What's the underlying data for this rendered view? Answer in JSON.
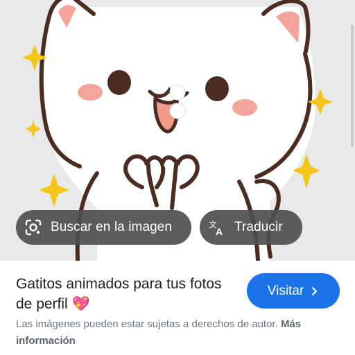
{
  "image_actions": {
    "lens_label": "Buscar en la imagen",
    "translate_label": "Traducir"
  },
  "result": {
    "title": "Gatitos animados para tus fotos de perfil",
    "title_emoji": "💖",
    "visit_label": "Visitar",
    "disclaimer": "Las imágenes pueden estar sujetas a derechos de autor.",
    "more_info": "Más información"
  },
  "colors": {
    "accent": "#1a73e8",
    "chip_bg": "#4e4e4e",
    "image_bg": "#e9e9e9",
    "cat_outline": "#4a2c22",
    "blush": "#f4a49a",
    "sparkle": "#f5c518"
  },
  "icons": [
    "google-lens-icon",
    "translate-icon",
    "chevron-right-icon",
    "sparkle-heart-emoji"
  ]
}
